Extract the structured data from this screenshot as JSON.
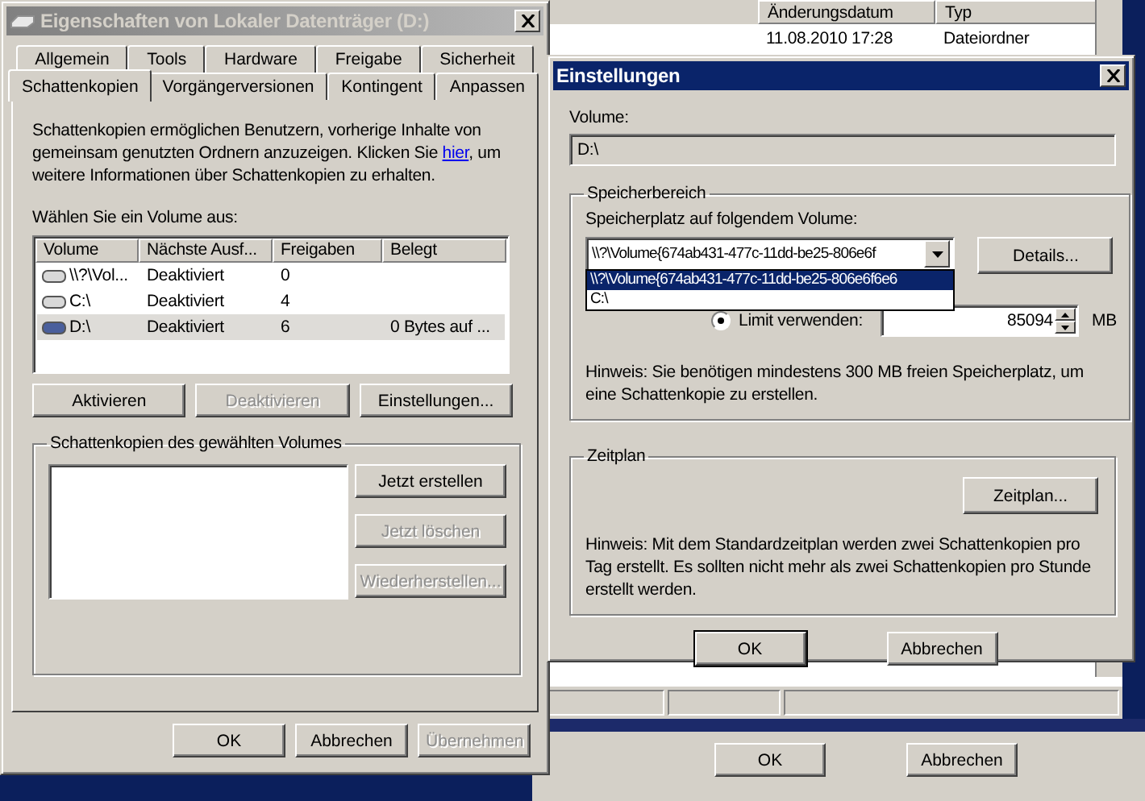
{
  "explorer": {
    "columns": [
      "Änderungsdatum",
      "Typ"
    ],
    "rows": [
      {
        "date": "11.08.2010 17:28",
        "type": "Dateiordner"
      }
    ]
  },
  "properties_window": {
    "title": "Eigenschaften von Lokaler Datenträger (D:)",
    "active": false,
    "tab_rows": [
      [
        {
          "label": "Allgemein",
          "selected": false
        },
        {
          "label": "Tools",
          "selected": false
        },
        {
          "label": "Hardware",
          "selected": false
        },
        {
          "label": "Freigabe",
          "selected": false
        },
        {
          "label": "Sicherheit",
          "selected": false
        }
      ],
      [
        {
          "label": "Schattenkopien",
          "selected": true
        },
        {
          "label": "Vorgängerversionen",
          "selected": false
        },
        {
          "label": "Kontingent",
          "selected": false
        },
        {
          "label": "Anpassen",
          "selected": false
        }
      ]
    ],
    "intro_before": "Schattenkopien ermöglichen Benutzern, vorherige Inhalte von gemeinsam genutzten Ordnern anzuzeigen. Klicken Sie ",
    "link": "hier",
    "intro_after": ", um weitere Informationen über Schattenkopien zu erhalten.",
    "volume_label": "Wählen Sie ein Volume aus:",
    "volume_columns": [
      "Volume",
      "Nächste Ausf...",
      "Freigaben",
      "Belegt"
    ],
    "volumes": [
      {
        "volume": "\\\\?\\Vol...",
        "next": "Deaktiviert",
        "shares": "0",
        "selected": false
      },
      {
        "volume": "C:\\",
        "next": "Deaktiviert",
        "shares": "4",
        "selected": false
      },
      {
        "volume": "D:\\",
        "next": "Deaktiviert",
        "shares": "6",
        "used": "0 Bytes auf ...",
        "selected": true
      }
    ],
    "volume_buttons": [
      {
        "label": "Aktivieren",
        "disabled": false
      },
      {
        "label": "Deaktivieren",
        "disabled": true
      },
      {
        "label": "Einstellungen...",
        "disabled": false
      }
    ],
    "copies_title": "Schattenkopien des gewählten Volumes",
    "copies_buttons": [
      {
        "label": "Jetzt erstellen",
        "disabled": false
      },
      {
        "label": "Jetzt löschen",
        "disabled": true
      },
      {
        "label": "Wiederherstellen...",
        "disabled": true
      }
    ],
    "footer_buttons": [
      {
        "label": "OK",
        "disabled": false
      },
      {
        "label": "Abbrechen",
        "disabled": false
      },
      {
        "label": "Übernehmen",
        "disabled": true
      }
    ]
  },
  "settings_dialog": {
    "title": "Einstellungen",
    "active": true,
    "volume_label": "Volume:",
    "volume_value": "D:\\",
    "storage": {
      "title": "Speicherbereich",
      "label": "Speicherplatz auf folgendem Volume:",
      "combo_value": "\\\\?\\Volume{674ab431-477c-11dd-be25-806e6f",
      "dropdown": [
        {
          "label": "\\\\?\\Volume{674ab431-477c-11dd-be25-806e6f6e6",
          "selected": true
        },
        {
          "label": "C:\\",
          "selected": false
        }
      ],
      "details_button": "Details...",
      "limit_radio": {
        "label": "Limit verwenden:",
        "selected": true
      },
      "limit_value": "85094",
      "unit": "MB",
      "hint": "Hinweis: Sie benötigen mindestens 300 MB freien Speicherplatz, um eine Schattenkopie zu erstellen."
    },
    "schedule": {
      "title": "Zeitplan",
      "button": "Zeitplan...",
      "hint": "Hinweis: Mit dem Standardzeitplan werden zwei Schattenkopien pro Tag erstellt. Es sollten nicht mehr als zwei Schattenkopien pro Stunde erstellt werden."
    },
    "buttons": [
      {
        "label": "OK",
        "default": true
      },
      {
        "label": "Abbrechen",
        "default": false
      }
    ]
  },
  "back_dialog": {
    "buttons": [
      {
        "label": "OK",
        "default": false
      },
      {
        "label": "Abbrechen",
        "default": false
      }
    ]
  }
}
